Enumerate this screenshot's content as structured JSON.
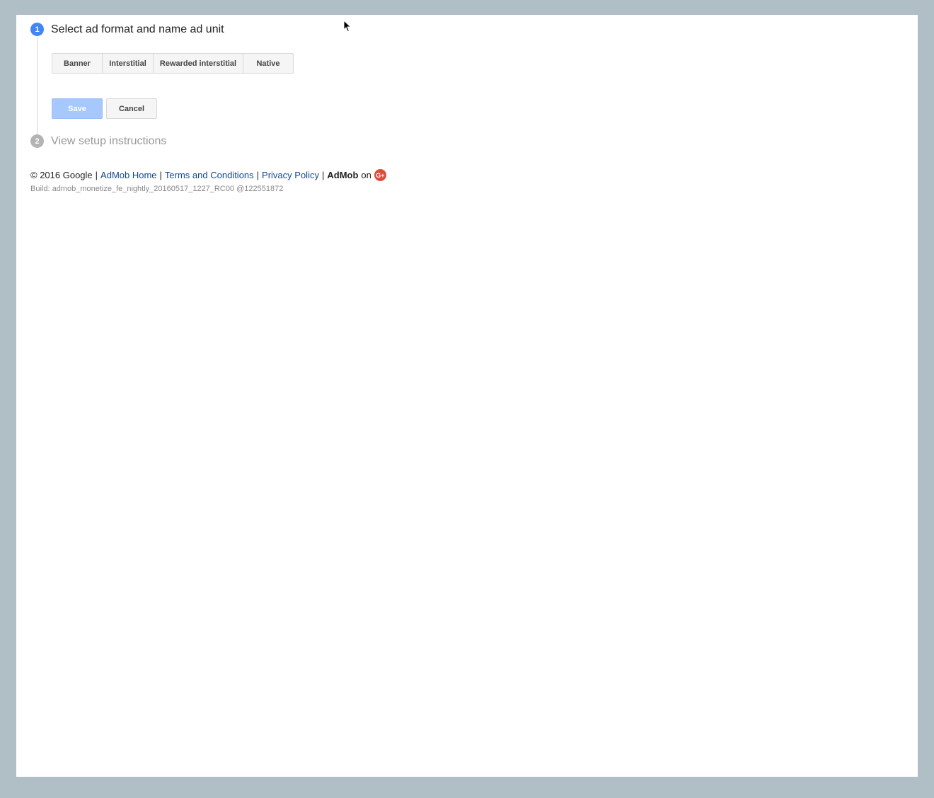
{
  "steps": [
    {
      "number": "1",
      "title": "Select ad format and name ad unit",
      "state": "active"
    },
    {
      "number": "2",
      "title": "View setup instructions",
      "state": "inactive"
    }
  ],
  "ad_formats": [
    {
      "label": "Banner"
    },
    {
      "label": "Interstitial"
    },
    {
      "label": "Rewarded interstitial"
    },
    {
      "label": "Native"
    }
  ],
  "actions": {
    "save_label": "Save",
    "cancel_label": "Cancel"
  },
  "footer": {
    "copyright": "© 2016 Google",
    "sep": "|",
    "links": [
      "AdMob Home",
      "Terms and Conditions",
      "Privacy Policy"
    ],
    "brand": "AdMob",
    "on_text": "on",
    "gplus_glyph": "G+",
    "build": "Build: admob_monetize_fe_nightly_20160517_1227_RC00 @122551872"
  },
  "colors": {
    "page_bg": "#b0bec5",
    "accent": "#4285f4",
    "save_disabled": "#a6c8ff",
    "link": "#15488a",
    "gplus": "#dd4b39"
  }
}
